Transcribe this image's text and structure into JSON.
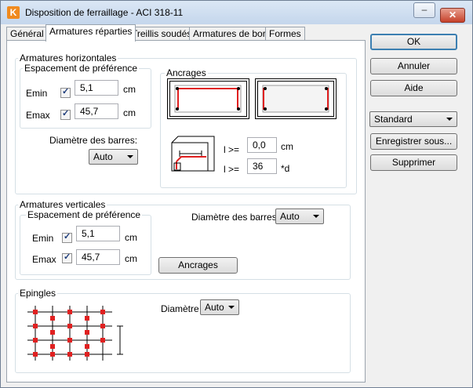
{
  "window": {
    "title": "Disposition de ferraillage - ACI 318-11",
    "app_icon": "K",
    "controls": {
      "minimize": "–",
      "maximize": "□",
      "close": "✕"
    }
  },
  "tabs": [
    {
      "label": "Général",
      "active": false
    },
    {
      "label": "Armatures réparties",
      "active": true
    },
    {
      "label": "Treillis soudés",
      "active": false
    },
    {
      "label": "Armatures de bord",
      "active": false
    },
    {
      "label": "Formes",
      "active": false
    }
  ],
  "horizontal": {
    "title": "Armatures horizontales",
    "spacing": {
      "title": "Espacement de préférence",
      "emin": {
        "label": "Emin",
        "checked": true,
        "value": "5,1",
        "unit": "cm"
      },
      "emax": {
        "label": "Emax",
        "checked": true,
        "value": "45,7",
        "unit": "cm"
      }
    },
    "diameter": {
      "label": "Diamètre des barres:",
      "value": "Auto"
    },
    "anchorages": {
      "title": "Ancrages",
      "l1": {
        "label": "l >=",
        "value": "0,0",
        "unit": "cm"
      },
      "l2": {
        "label": "l >=",
        "value": "36",
        "unit": "*d"
      }
    }
  },
  "vertical": {
    "title": "Armatures verticales",
    "spacing": {
      "title": "Espacement de préférence",
      "emin": {
        "label": "Emin",
        "checked": true,
        "value": "5,1",
        "unit": "cm"
      },
      "emax": {
        "label": "Emax",
        "checked": true,
        "value": "45,7",
        "unit": "cm"
      }
    },
    "diameter": {
      "label": "Diamètre des barres:",
      "value": "Auto"
    },
    "anchorages_button": "Ancrages"
  },
  "pins": {
    "title": "Epingles",
    "diameter": {
      "label": "Diamètre",
      "value": "Auto"
    }
  },
  "side": {
    "ok": "OK",
    "cancel": "Annuler",
    "help": "Aide",
    "preset": "Standard",
    "save_as": "Enregistrer sous...",
    "delete": "Supprimer"
  },
  "colors": {
    "rebar_red": "#e02020",
    "accent_blue": "#3c7fb1"
  }
}
